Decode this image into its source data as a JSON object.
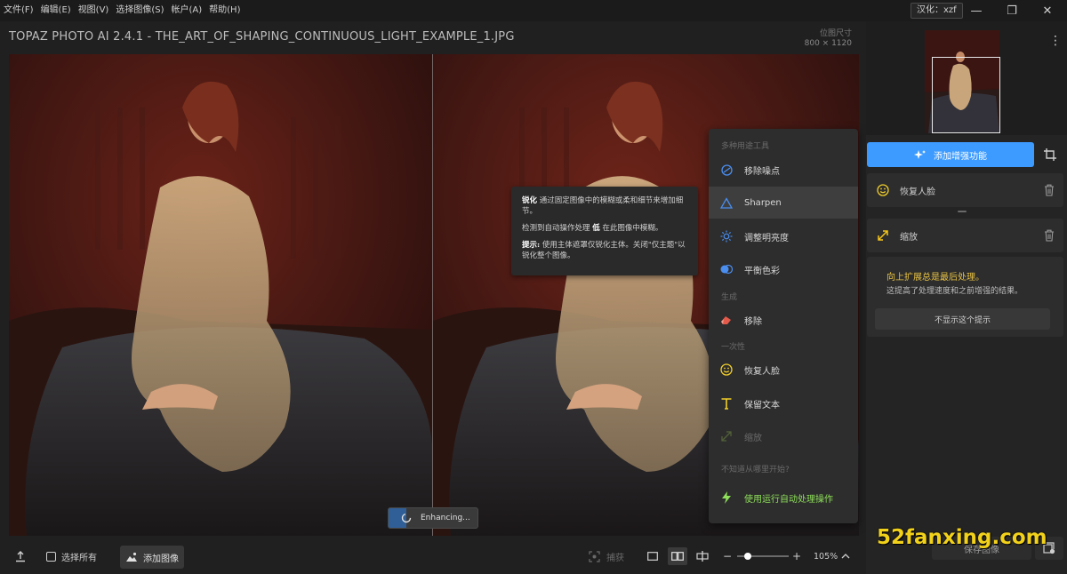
{
  "menu": {
    "items": [
      "文件(F)",
      "编辑(E)",
      "视图(V)",
      "选择图像(S)",
      "帐户(A)",
      "帮助(H)"
    ],
    "lang_badge": "汉化：xzf"
  },
  "window": {
    "minimize": "—",
    "restore": "❐",
    "close": "✕"
  },
  "header": {
    "title": "TOPAZ PHOTO AI 2.4.1 - THE_ART_OF_SHAPING_CONTINUOUS_LIGHT_EXAMPLE_1.JPG",
    "dim_label": "位图尺寸",
    "dim_value": "800 × 1120"
  },
  "tooltip": {
    "line1_bold": "锐化",
    "line1_rest": " 通过固定图像中的模糊或柔和细节来增加细节。",
    "line2_pre": "检测到自动操作处理 ",
    "line2_bold": "低",
    "line2_post": " 在此图像中模糊。",
    "line3_bold": "提示:",
    "line3_rest": " 使用主体遮罩仅锐化主体。关闭\"仅主题\"以锐化整个图像。"
  },
  "tools": {
    "section_multi": "多种用途工具",
    "denoise": "移除噪点",
    "sharpen": "Sharpen",
    "lighting": "调整明亮度",
    "color": "平衡色彩",
    "section_generate": "生成",
    "remove": "移除",
    "section_once": "一次性",
    "face": "恢复人脸",
    "text": "保留文本",
    "upscale": "缩放",
    "section_hint": "不知道从哪里开始?",
    "autopilot": "使用运行自动处理操作"
  },
  "enhancing": {
    "label": "Enhancing...",
    "progress": 0.2
  },
  "bottombar": {
    "select_all": "选择所有",
    "add_image": "添加图像",
    "capture": "捕获",
    "zoom_value": "105%",
    "zoom_level": 0.2,
    "minus": "−",
    "plus": "+"
  },
  "rpanel": {
    "add_enhancement": "添加增强功能",
    "face_card": "恢复人脸",
    "upscale_card": "缩放",
    "tip_title": "向上扩展总是最后处理。",
    "tip_body": "这提高了处理速度和之前增强的结果。",
    "tip_button": "不显示这个提示",
    "export": "保存图像"
  },
  "watermark": "52fanxing.com",
  "colors": {
    "accent_blue": "#3d9bff",
    "tip_yellow": "#e8c244",
    "autopilot_green": "#8ee05a",
    "upscale_yellow": "#f5c518",
    "face_yellow": "#f2cf2a"
  }
}
